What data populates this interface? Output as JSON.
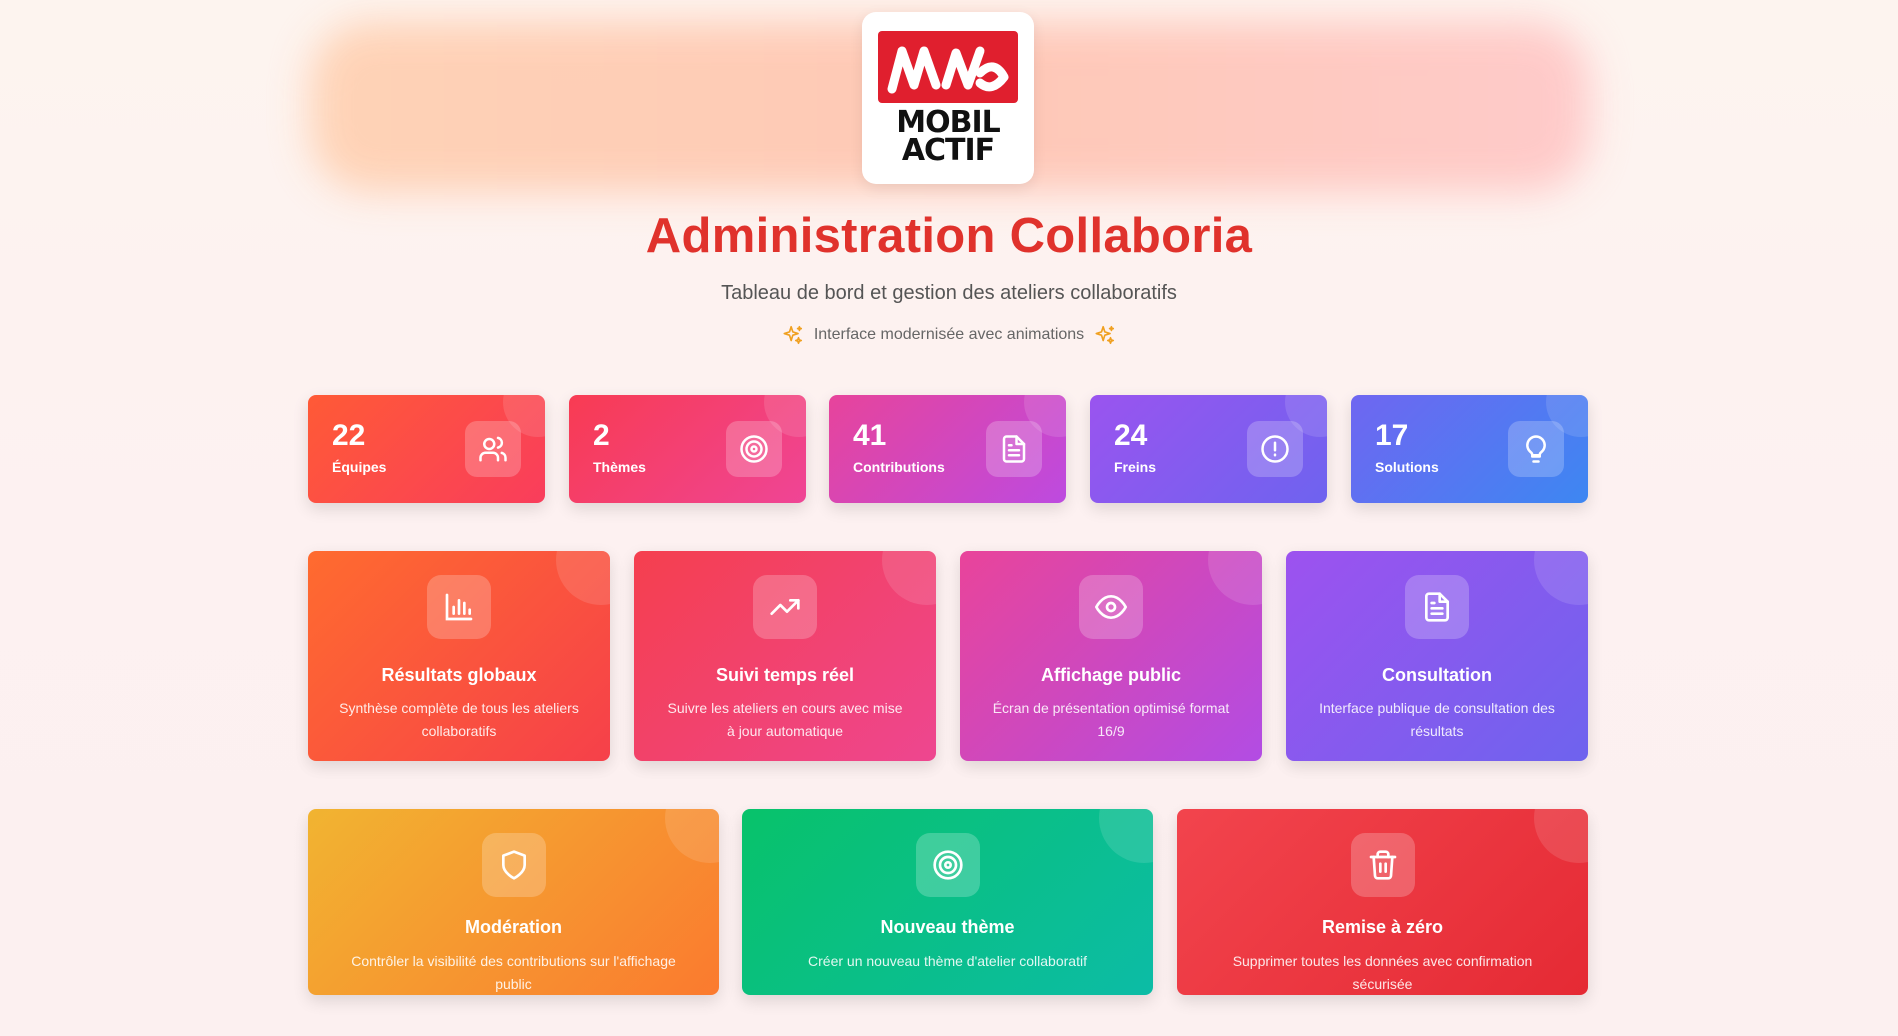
{
  "brand": {
    "logo_line1": "MOBIL",
    "logo_line2": "ACTIF",
    "logo_icon": "mobilactif-logo-mark"
  },
  "header": {
    "title": "Administration Collaboria",
    "subtitle": "Tableau de bord et gestion des ateliers collaboratifs",
    "tagline": "Interface modernisée avec animations",
    "tagline_icon": "sparkles-icon"
  },
  "stats": [
    {
      "value": "22",
      "label": "Équipes",
      "icon": "users-icon",
      "gradient": [
        "#ff5a36",
        "#f93d5c"
      ]
    },
    {
      "value": "2",
      "label": "Thèmes",
      "icon": "target-icon",
      "gradient": [
        "#f83b52",
        "#ef4596"
      ]
    },
    {
      "value": "41",
      "label": "Contributions",
      "icon": "file-text-icon",
      "gradient": [
        "#e7449b",
        "#bd4ae0"
      ]
    },
    {
      "value": "24",
      "label": "Freins",
      "icon": "alert-circle-icon",
      "gradient": [
        "#9a54ef",
        "#6e63ef"
      ]
    },
    {
      "value": "17",
      "label": "Solutions",
      "icon": "lightbulb-icon",
      "gradient": [
        "#6f66f1",
        "#3d87f2"
      ]
    }
  ],
  "actions_primary": [
    {
      "title": "Résultats globaux",
      "description": "Synthèse complète de tous les ateliers collaboratifs",
      "icon": "bar-chart-icon",
      "gradient": [
        "#ff6b2f",
        "#f6404a"
      ]
    },
    {
      "title": "Suivi temps réel",
      "description": "Suivre les ateliers en cours avec mise à jour automatique",
      "icon": "trending-up-icon",
      "gradient": [
        "#f53f4e",
        "#ee4690"
      ]
    },
    {
      "title": "Affichage public",
      "description": "Écran de présentation optimisé format 16/9",
      "icon": "eye-icon",
      "gradient": [
        "#e9449a",
        "#b24ce4"
      ]
    },
    {
      "title": "Consultation",
      "description": "Interface publique de consultation des résultats",
      "icon": "file-text-icon",
      "gradient": [
        "#9d52ef",
        "#6e63ee"
      ]
    }
  ],
  "actions_secondary": [
    {
      "title": "Modération",
      "description": "Contrôler la visibilité des contributions sur l'affichage public",
      "icon": "shield-icon",
      "gradient": [
        "#f1b431",
        "#fb7a2f"
      ]
    },
    {
      "title": "Nouveau thème",
      "description": "Créer un nouveau thème d'atelier collaboratif",
      "icon": "target-icon",
      "gradient": [
        "#08c26a",
        "#0cbca6"
      ]
    },
    {
      "title": "Remise à zéro",
      "description": "Supprimer toutes les données avec confirmation sécurisée",
      "icon": "trash-icon",
      "gradient": [
        "#f2444d",
        "#e52a34"
      ]
    }
  ]
}
